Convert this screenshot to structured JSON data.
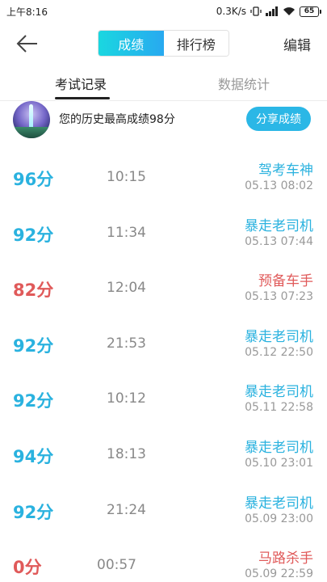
{
  "status_bar": {
    "time": "上午8:16",
    "speed": "0.3K/s",
    "battery": "65"
  },
  "header": {
    "tabs": [
      "成绩",
      "排行榜"
    ],
    "active_tab": "成绩",
    "edit_label": "编辑"
  },
  "sub_tabs": [
    "考试记录",
    "数据统计"
  ],
  "best": {
    "text": "您的历史最高成绩98分",
    "share_label": "分享成绩"
  },
  "colors": {
    "accent": "#2ab2df",
    "fail": "#e05a5a"
  },
  "records": [
    {
      "score": "96分",
      "duration": "10:15",
      "title": "驾考车神",
      "date": "05.13  08:02",
      "status": "pass"
    },
    {
      "score": "92分",
      "duration": "11:34",
      "title": "暴走老司机",
      "date": "05.13  07:44",
      "status": "pass"
    },
    {
      "score": "82分",
      "duration": "12:04",
      "title": "预备车手",
      "date": "05.13  07:23",
      "status": "fail"
    },
    {
      "score": "92分",
      "duration": "21:53",
      "title": "暴走老司机",
      "date": "05.12  22:50",
      "status": "pass"
    },
    {
      "score": "92分",
      "duration": "10:12",
      "title": "暴走老司机",
      "date": "05.11  22:58",
      "status": "pass"
    },
    {
      "score": "94分",
      "duration": "18:13",
      "title": "暴走老司机",
      "date": "05.10  23:01",
      "status": "pass"
    },
    {
      "score": "92分",
      "duration": "21:24",
      "title": "暴走老司机",
      "date": "05.09  23:00",
      "status": "pass"
    },
    {
      "score": "0分",
      "duration": "00:57",
      "title": "马路杀手",
      "date": "05.09  22:59",
      "status": "fail"
    }
  ]
}
